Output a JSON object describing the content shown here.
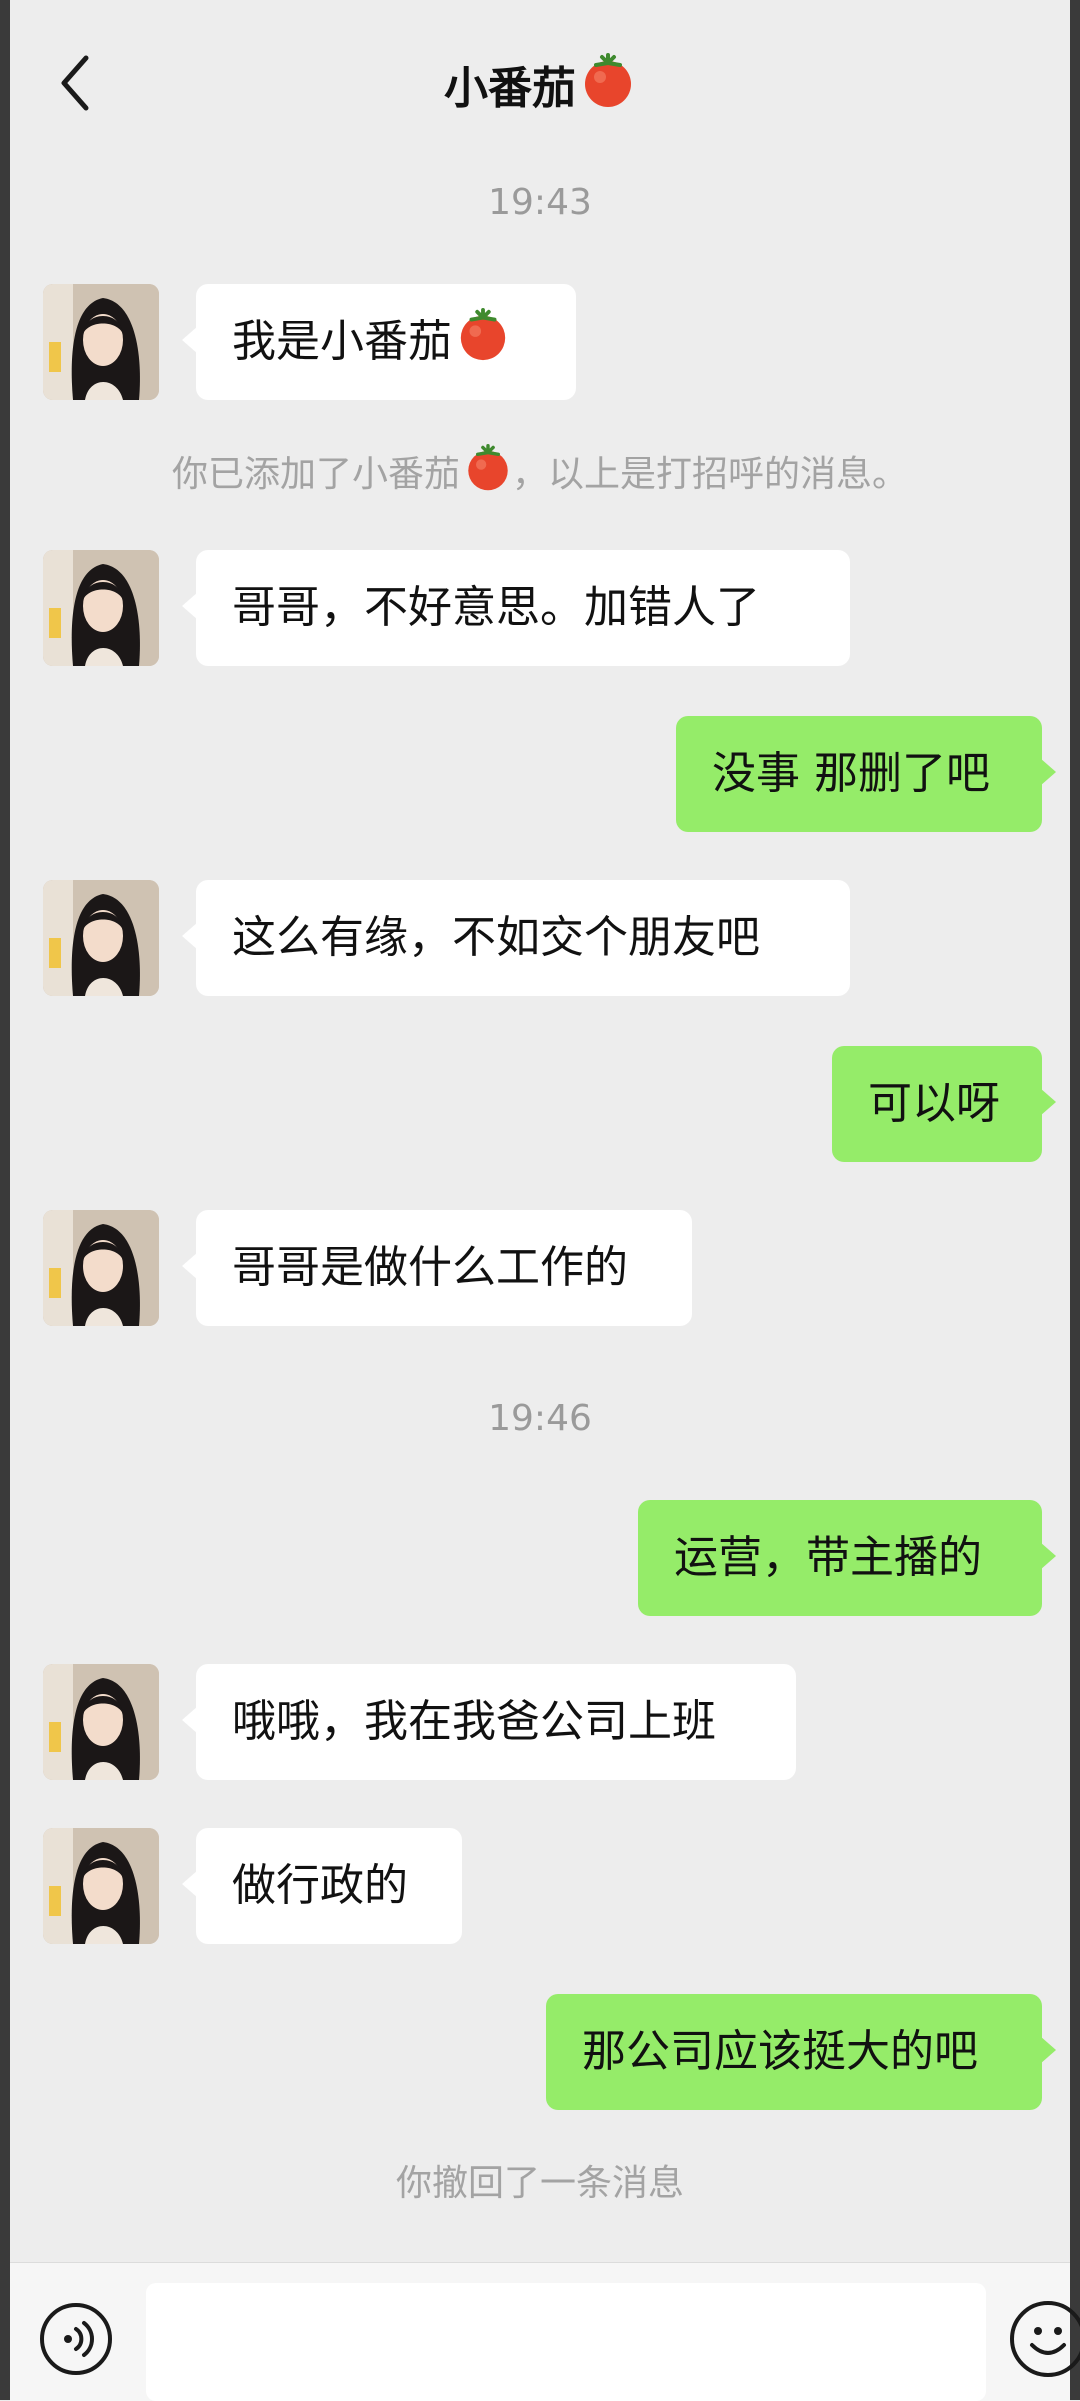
{
  "header": {
    "title": "小番茄",
    "title_emoji": "tomato-icon"
  },
  "messages": [
    {
      "kind": "time",
      "text": "19:43"
    },
    {
      "kind": "in",
      "text": "我是小番茄",
      "emoji": "tomato-icon"
    },
    {
      "kind": "notice",
      "text_before": "你已添加了小番茄",
      "emoji": "tomato-icon",
      "text_after": "，以上是打招呼的消息。"
    },
    {
      "kind": "in",
      "text": "哥哥，不好意思。加错人了"
    },
    {
      "kind": "out",
      "text": "没事 那删了吧"
    },
    {
      "kind": "in",
      "text": "这么有缘，不如交个朋友吧"
    },
    {
      "kind": "out",
      "text": "可以呀"
    },
    {
      "kind": "in",
      "text": "哥哥是做什么工作的"
    },
    {
      "kind": "time",
      "text": "19:46"
    },
    {
      "kind": "out",
      "text": "运营，带主播的"
    },
    {
      "kind": "in",
      "text": "哦哦，我在我爸公司上班"
    },
    {
      "kind": "in",
      "text": "做行政的"
    },
    {
      "kind": "out",
      "text": "那公司应该挺大的吧"
    },
    {
      "kind": "notice",
      "text": "你撤回了一条消息"
    }
  ],
  "input": {
    "value": ""
  },
  "colors": {
    "background": "#ededed",
    "incoming_bubble": "#ffffff",
    "outgoing_bubble": "#95ec69",
    "timestamp_text": "#9a9a9a"
  },
  "icons": {
    "back": "chevron-left-icon",
    "voice": "voice-icon",
    "emoji": "emoji-icon",
    "avatar": "contact-avatar"
  }
}
